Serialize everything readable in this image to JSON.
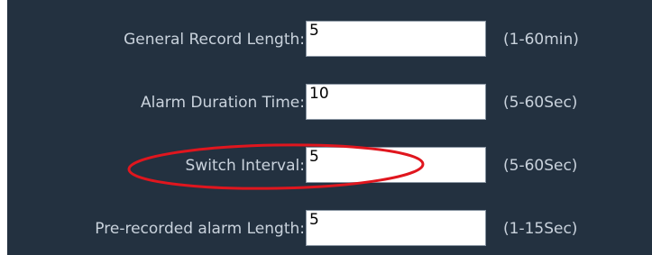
{
  "settings": {
    "rows": [
      {
        "label": "General Record Length:",
        "value": "5",
        "range": "(1-60min)"
      },
      {
        "label": "Alarm Duration Time:",
        "value": "10",
        "range": "(5-60Sec)"
      },
      {
        "label": "Switch Interval:",
        "value": "5",
        "range": "(5-60Sec)"
      },
      {
        "label": "Pre-recorded alarm Length:",
        "value": "5",
        "range": "(1-15Sec)"
      }
    ]
  },
  "colors": {
    "panel_background": "#233140",
    "label_text": "#c9d2dc",
    "annotation": "#e0161e"
  }
}
